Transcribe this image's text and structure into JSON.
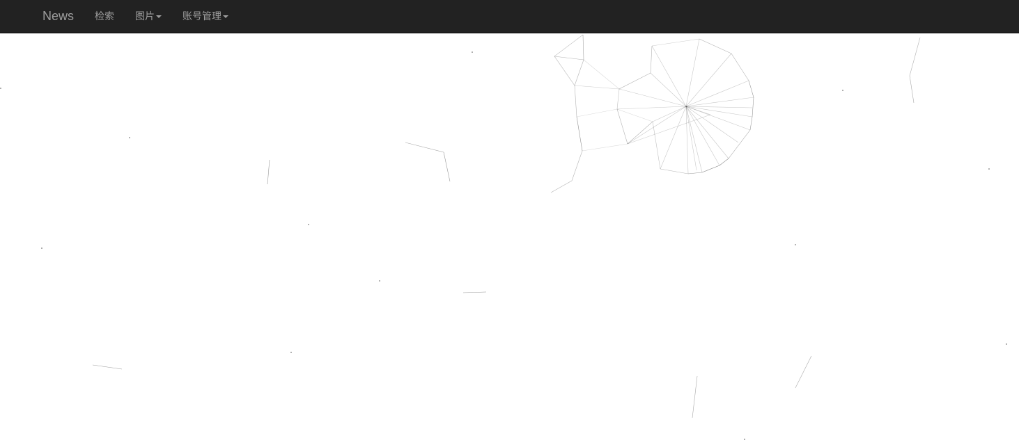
{
  "navbar": {
    "brand": "News",
    "items": [
      {
        "label": "检索"
      },
      {
        "label": "图片"
      },
      {
        "label": "账号管理"
      }
    ]
  }
}
